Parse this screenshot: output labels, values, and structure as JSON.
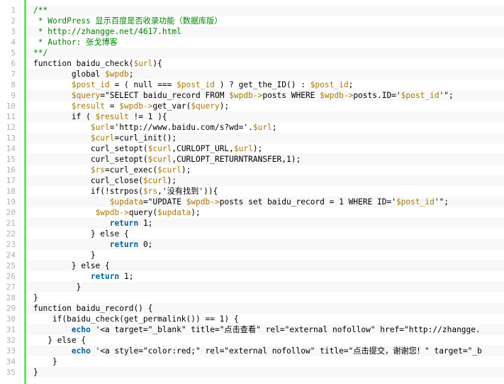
{
  "code": {
    "lines": [
      {
        "n": "1",
        "tokens": [
          [
            "comment",
            "/**"
          ]
        ]
      },
      {
        "n": "2",
        "tokens": [
          [
            "comment",
            " * WordPress 显示百度是否收录功能（数据库版）"
          ]
        ]
      },
      {
        "n": "3",
        "tokens": [
          [
            "comment",
            " * http://zhangge.net/4617.html"
          ]
        ]
      },
      {
        "n": "4",
        "tokens": [
          [
            "comment",
            " * Author: 张戈博客"
          ]
        ]
      },
      {
        "n": "5",
        "tokens": [
          [
            "comment",
            "**/"
          ]
        ]
      },
      {
        "n": "6",
        "tokens": [
          [
            "plain",
            "function baidu_check("
          ],
          [
            "var",
            "$url"
          ],
          [
            "plain",
            "){"
          ]
        ]
      },
      {
        "n": "7",
        "tokens": [
          [
            "plain",
            "        global "
          ],
          [
            "var",
            "$wpdb"
          ],
          [
            "plain",
            ";"
          ]
        ]
      },
      {
        "n": "8",
        "tokens": [
          [
            "plain",
            "        "
          ],
          [
            "var",
            "$post_id"
          ],
          [
            "plain",
            " = ( null === "
          ],
          [
            "var",
            "$post_id"
          ],
          [
            "plain",
            " ) ? get_the_ID() : "
          ],
          [
            "var",
            "$post_id"
          ],
          [
            "plain",
            ";"
          ]
        ]
      },
      {
        "n": "9",
        "tokens": [
          [
            "plain",
            "        "
          ],
          [
            "var",
            "$query"
          ],
          [
            "plain",
            "=\"SELECT baidu_record FROM "
          ],
          [
            "var",
            "$wpdb->"
          ],
          [
            "plain",
            "posts WHERE "
          ],
          [
            "var",
            "$wpdb->"
          ],
          [
            "plain",
            "posts.ID='"
          ],
          [
            "var",
            "$post_id"
          ],
          [
            "plain",
            "'\";"
          ]
        ]
      },
      {
        "n": "10",
        "tokens": [
          [
            "plain",
            "        "
          ],
          [
            "var",
            "$result"
          ],
          [
            "plain",
            " = "
          ],
          [
            "var",
            "$wpdb->"
          ],
          [
            "plain",
            "get_var("
          ],
          [
            "var",
            "$query"
          ],
          [
            "plain",
            ");"
          ]
        ]
      },
      {
        "n": "11",
        "tokens": [
          [
            "plain",
            "        if ( "
          ],
          [
            "var",
            "$result"
          ],
          [
            "plain",
            " != 1 ){"
          ]
        ]
      },
      {
        "n": "12",
        "tokens": [
          [
            "plain",
            "            "
          ],
          [
            "var",
            "$url"
          ],
          [
            "plain",
            "='http://www.baidu.com/s?wd='."
          ],
          [
            "var",
            "$url"
          ],
          [
            "plain",
            ";"
          ]
        ]
      },
      {
        "n": "13",
        "tokens": [
          [
            "plain",
            "            "
          ],
          [
            "var",
            "$curl"
          ],
          [
            "plain",
            "=curl_init();"
          ]
        ]
      },
      {
        "n": "14",
        "tokens": [
          [
            "plain",
            "            curl_setopt("
          ],
          [
            "var",
            "$curl"
          ],
          [
            "plain",
            ",CURLOPT_URL,"
          ],
          [
            "var",
            "$url"
          ],
          [
            "plain",
            ");"
          ]
        ]
      },
      {
        "n": "15",
        "tokens": [
          [
            "plain",
            "            curl_setopt("
          ],
          [
            "var",
            "$curl"
          ],
          [
            "plain",
            ",CURLOPT_RETURNTRANSFER,1);"
          ]
        ]
      },
      {
        "n": "16",
        "tokens": [
          [
            "plain",
            "            "
          ],
          [
            "var",
            "$rs"
          ],
          [
            "plain",
            "=curl_exec("
          ],
          [
            "var",
            "$curl"
          ],
          [
            "plain",
            ");"
          ]
        ]
      },
      {
        "n": "17",
        "tokens": [
          [
            "plain",
            "            curl_close("
          ],
          [
            "var",
            "$curl"
          ],
          [
            "plain",
            ");"
          ]
        ]
      },
      {
        "n": "18",
        "tokens": [
          [
            "plain",
            "            if(!strpos("
          ],
          [
            "var",
            "$rs"
          ],
          [
            "plain",
            ",'没有找到')){"
          ]
        ]
      },
      {
        "n": "19",
        "tokens": [
          [
            "plain",
            "                "
          ],
          [
            "var",
            "$updata"
          ],
          [
            "plain",
            "=\"UPDATE "
          ],
          [
            "var",
            "$wpdb->"
          ],
          [
            "plain",
            "posts set baidu_record = 1 WHERE ID='"
          ],
          [
            "var",
            "$post_id"
          ],
          [
            "plain",
            "'\";"
          ]
        ]
      },
      {
        "n": "20",
        "tokens": [
          [
            "plain",
            "             "
          ],
          [
            "var",
            "$wpdb->"
          ],
          [
            "plain",
            "query("
          ],
          [
            "var",
            "$updata"
          ],
          [
            "plain",
            ");"
          ]
        ]
      },
      {
        "n": "21",
        "tokens": [
          [
            "plain",
            "                "
          ],
          [
            "kw",
            "return"
          ],
          [
            "plain",
            " 1;"
          ]
        ]
      },
      {
        "n": "22",
        "tokens": [
          [
            "plain",
            "            } else {"
          ]
        ]
      },
      {
        "n": "23",
        "tokens": [
          [
            "plain",
            "                "
          ],
          [
            "kw",
            "return"
          ],
          [
            "plain",
            " 0;"
          ]
        ]
      },
      {
        "n": "24",
        "tokens": [
          [
            "plain",
            "            }"
          ]
        ]
      },
      {
        "n": "25",
        "tokens": [
          [
            "plain",
            "        } else {"
          ]
        ]
      },
      {
        "n": "26",
        "tokens": [
          [
            "plain",
            "            "
          ],
          [
            "kw",
            "return"
          ],
          [
            "plain",
            " 1;"
          ]
        ]
      },
      {
        "n": "27",
        "tokens": [
          [
            "plain",
            "         }"
          ]
        ]
      },
      {
        "n": "28",
        "tokens": [
          [
            "plain",
            "}"
          ]
        ]
      },
      {
        "n": "29",
        "tokens": [
          [
            "plain",
            "function baidu_record() {"
          ]
        ]
      },
      {
        "n": "30",
        "tokens": [
          [
            "plain",
            "    if(baidu_check(get_permalink()) == 1) {"
          ]
        ]
      },
      {
        "n": "31",
        "tokens": [
          [
            "plain",
            "        "
          ],
          [
            "kw",
            "echo"
          ],
          [
            "plain",
            " '<a target=\"_blank\" title=\"点击查看\" rel=\"external nofollow\" href=\"http://zhangge."
          ]
        ]
      },
      {
        "n": "32",
        "tokens": [
          [
            "plain",
            "   } else {"
          ]
        ]
      },
      {
        "n": "33",
        "tokens": [
          [
            "plain",
            "        "
          ],
          [
            "kw",
            "echo"
          ],
          [
            "plain",
            " '<a style=\"color:red;\" rel=\"external nofollow\" title=\"点击提交，谢谢您！\" target=\"_b"
          ]
        ]
      },
      {
        "n": "34",
        "tokens": [
          [
            "plain",
            "    }"
          ]
        ]
      },
      {
        "n": "35",
        "tokens": [
          [
            "plain",
            "}"
          ]
        ]
      }
    ]
  },
  "colors": {
    "gutter_bar": "#6ce26c",
    "line_number": "#afafaf",
    "comment": "#008200",
    "variable": "#aa7700",
    "keyword": "#006699"
  }
}
